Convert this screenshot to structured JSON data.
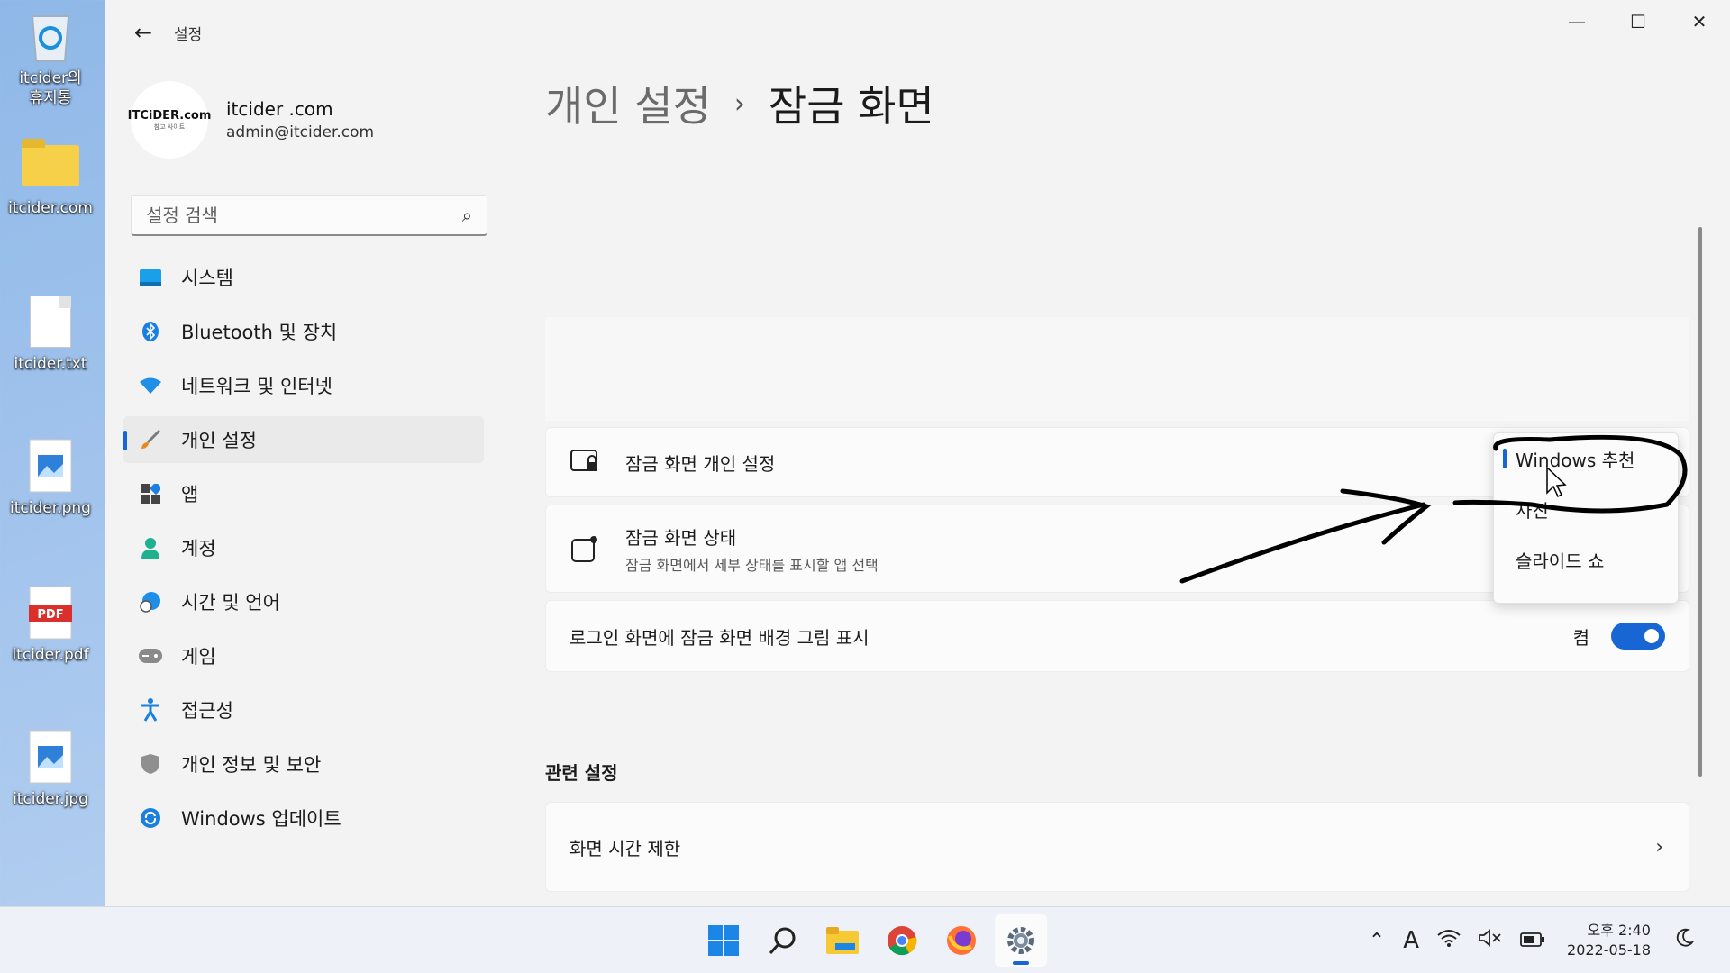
{
  "desktop": {
    "icons": [
      {
        "label": "itcider의\n휴지통",
        "icon": "recycle-bin-icon"
      },
      {
        "label": "itcider.com",
        "icon": "folder-icon"
      },
      {
        "label": "itcider.txt",
        "icon": "text-file-icon"
      },
      {
        "label": "itcider.png",
        "icon": "image-file-icon"
      },
      {
        "label": "itcider.pdf",
        "icon": "pdf-file-icon"
      },
      {
        "label": "itcider.jpg",
        "icon": "image-file-icon"
      }
    ],
    "pdf_badge": "PDF"
  },
  "window": {
    "app_title": "설정",
    "controls": {
      "minimize": "—",
      "maximize": "☐",
      "close": "✕"
    }
  },
  "profile": {
    "avatar_text": "ITCiDER.com",
    "avatar_sub": "참고 사이트",
    "name": "itcider .com",
    "email": "admin@itcider.com"
  },
  "search": {
    "placeholder": "설정 검색"
  },
  "nav": {
    "items": [
      {
        "label": "시스템",
        "icon": "monitor-icon"
      },
      {
        "label": "Bluetooth 및 장치",
        "icon": "bluetooth-icon"
      },
      {
        "label": "네트워크 및 인터넷",
        "icon": "wifi-icon"
      },
      {
        "label": "개인 설정",
        "icon": "brush-icon",
        "active": true
      },
      {
        "label": "앱",
        "icon": "apps-icon"
      },
      {
        "label": "계정",
        "icon": "person-icon"
      },
      {
        "label": "시간 및 언어",
        "icon": "globe-clock-icon"
      },
      {
        "label": "게임",
        "icon": "gamepad-icon"
      },
      {
        "label": "접근성",
        "icon": "accessibility-icon"
      },
      {
        "label": "개인 정보 및 보안",
        "icon": "shield-icon"
      },
      {
        "label": "Windows 업데이트",
        "icon": "update-icon"
      }
    ]
  },
  "main": {
    "breadcrumb_parent": "개인 설정",
    "breadcrumb_sep": "›",
    "breadcrumb_current": "잠금 화면",
    "personalize": {
      "title": "잠금 화면 개인 설정"
    },
    "status": {
      "title": "잠금 화면 상태",
      "subtitle": "잠금 화면에서 세부 상태를 표시할 앱 선택"
    },
    "login_bg": {
      "title": "로그인 화면에 잠금 화면 배경 그림 표시",
      "toggle_label": "켬",
      "toggle_on": true
    },
    "related_title": "관련 설정",
    "screen_timeout": {
      "title": "화면 시간 제한"
    }
  },
  "dropdown": {
    "options": [
      "Windows 추천",
      "사진",
      "슬라이드 쇼"
    ],
    "selected": "Windows 추천"
  },
  "taskbar": {
    "apps": [
      "start-icon",
      "search-icon",
      "file-explorer-icon",
      "chrome-icon",
      "firefox-icon",
      "settings-icon"
    ],
    "ime": "A",
    "time": "오후 2:40",
    "date": "2022-05-18"
  },
  "colors": {
    "accent": "#1866d4"
  }
}
